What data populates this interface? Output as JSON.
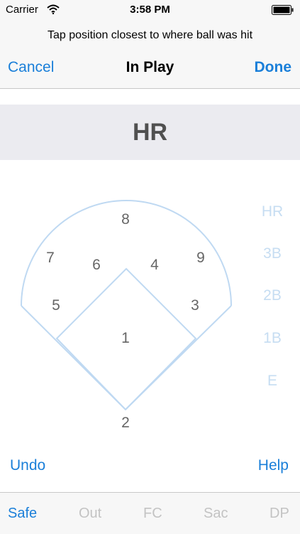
{
  "status": {
    "carrier": "Carrier",
    "time": "3:58 PM"
  },
  "prompt": "Tap position closest to where ball was hit",
  "nav": {
    "cancel": "Cancel",
    "title": "In Play",
    "done": "Done"
  },
  "result": "HR",
  "positions": {
    "p1": "1",
    "p2": "2",
    "p3": "3",
    "p4": "4",
    "p5": "5",
    "p6": "6",
    "p7": "7",
    "p8": "8",
    "p9": "9"
  },
  "base_options": [
    "HR",
    "3B",
    "2B",
    "1B",
    "E"
  ],
  "actions": {
    "undo": "Undo",
    "help": "Help"
  },
  "tabs": [
    "Safe",
    "Out",
    "FC",
    "Sac",
    "DP"
  ],
  "active_tab": "Safe",
  "colors": {
    "accent": "#1a7fd9",
    "field_line": "#bfd9f2",
    "disabled_option": "#c6ddf2",
    "banner_bg": "#ebebf0"
  },
  "icons": [
    "wifi-icon",
    "battery-icon"
  ]
}
